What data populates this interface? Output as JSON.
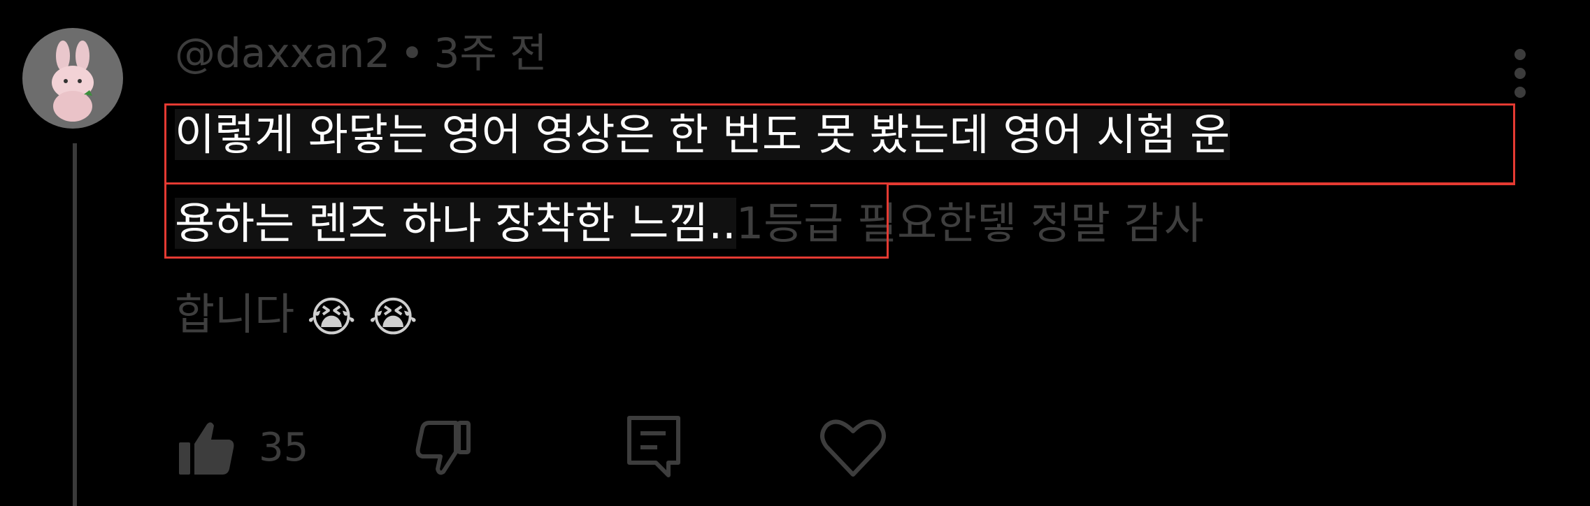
{
  "comment": {
    "username": "@daxxan2",
    "separator": "•",
    "time": "3주 전",
    "highlighted_line1": "이렇게 와닿는 영어 영상은 한 번도 못 봤는데 영어 시험 운",
    "highlighted_line2": "용하는 렌즈 하나 장착한 느낌..",
    "dim_line2": "1등급 필요한뎋 정말 감사",
    "dim_line3": "합니다",
    "emojis": [
      "😭",
      "😭"
    ]
  },
  "actions": {
    "like_count": "35"
  },
  "icons": {
    "avatar": "bunny-avatar-icon",
    "menu": "kebab-menu-icon",
    "like": "thumbs-up-icon",
    "dislike": "thumbs-down-icon",
    "reply": "reply-icon",
    "heart": "heart-icon"
  },
  "colors": {
    "background": "#000000",
    "highlight_border": "#e43a32",
    "dim_text": "#3e3e3e"
  }
}
